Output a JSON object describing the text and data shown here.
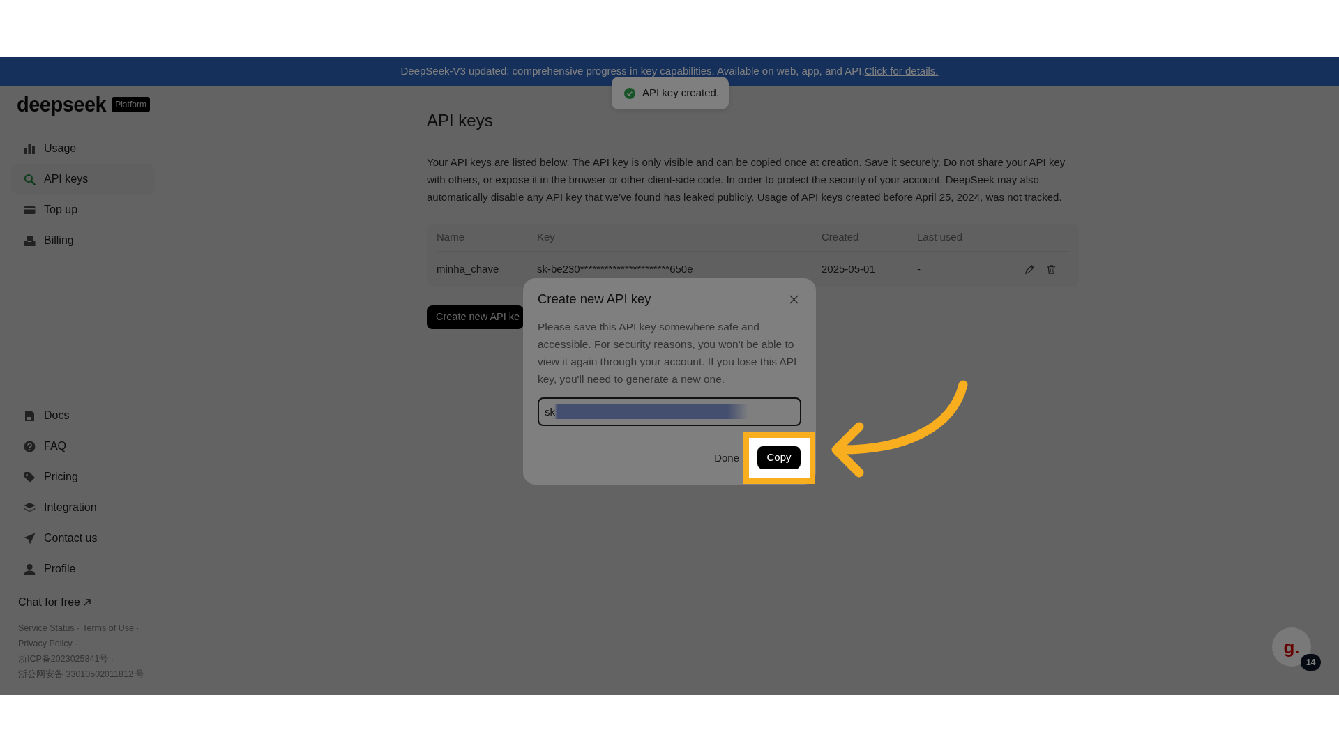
{
  "banner": {
    "text": "DeepSeek-V3 updated: comprehensive progress in key capabilities. Available on web, app, and API.",
    "link": "Click for details."
  },
  "toast": {
    "text": "API key created.",
    "kind": "success"
  },
  "logo": {
    "brand": "deepseek",
    "badge": "Platform"
  },
  "sidebar": {
    "items": [
      {
        "label": "Usage",
        "kind": "usage",
        "selected": false
      },
      {
        "label": "API keys",
        "kind": "keys",
        "selected": true
      },
      {
        "label": "Top up",
        "kind": "topup",
        "selected": false
      },
      {
        "label": "Billing",
        "kind": "billing",
        "selected": false
      }
    ],
    "bottom_items": [
      {
        "label": "Docs",
        "kind": "docs",
        "selected": false
      },
      {
        "label": "FAQ",
        "kind": "faq",
        "selected": false
      },
      {
        "label": "Pricing",
        "kind": "pricing",
        "selected": false
      },
      {
        "label": "Integration",
        "kind": "integration",
        "selected": false
      },
      {
        "label": "Contact us",
        "kind": "contact",
        "selected": false
      },
      {
        "label": "Profile",
        "kind": "profile",
        "selected": false
      }
    ],
    "chat_link": "Chat for free",
    "footer": {
      "separator": "·",
      "links": [
        "Service Status",
        "Terms of Use",
        "Privacy Policy",
        "浙ICP备2023025841号",
        "浙公网安备 33010502011812 号"
      ]
    }
  },
  "page": {
    "title": "API keys",
    "description": "Your API keys are listed below. The API key is only visible and can be copied once at creation. Save it securely. Do not share your API key with others, or expose it in the browser or other client-side code. In order to protect the security of your account, DeepSeek may also automatically disable any API key that we've found has leaked publicly. Usage of API keys created before April 25, 2024, was not tracked.",
    "table": {
      "columns": [
        "Name",
        "Key",
        "Created",
        "Last used"
      ],
      "rows": [
        {
          "name": "minha_chave",
          "key": "sk-be230**********************650e",
          "created": "2025-05-01",
          "last_used": "-"
        }
      ]
    },
    "create_button": "Create new API ke"
  },
  "dialog": {
    "title": "Create new API key",
    "message": "Please save this API key somewhere safe and accessible. For security reasons, you won't be able to view it again through your account. If you lose this API key, you'll need to generate a new one.",
    "key_value": "sk",
    "buttons": [
      {
        "label": "Done",
        "kind": "text",
        "highlighted": false
      },
      {
        "label": "Copy",
        "kind": "primary",
        "highlighted": true
      }
    ]
  },
  "help": {
    "logo": "g.",
    "badge": "14"
  }
}
